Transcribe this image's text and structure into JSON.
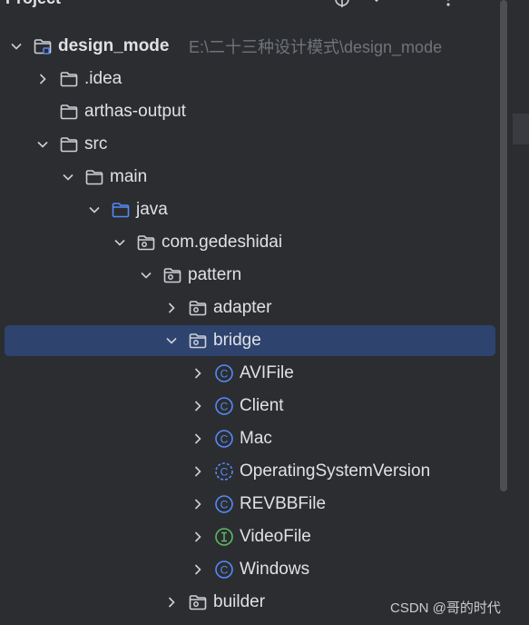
{
  "header": {
    "title": "Project",
    "icons": [
      "target-icon",
      "chevron-down-icon",
      "more-icon"
    ]
  },
  "tree": [
    {
      "label": "design_mode",
      "path": "E:\\二十三种设计模式\\design_mode",
      "icon": "module-folder-icon",
      "chevron": "expanded",
      "bold": true
    },
    {
      "label": ".idea",
      "icon": "folder-icon",
      "chevron": "collapsed"
    },
    {
      "label": "arthas-output",
      "icon": "folder-icon",
      "chevron": "none"
    },
    {
      "label": "src",
      "icon": "folder-icon",
      "chevron": "expanded"
    },
    {
      "label": "main",
      "icon": "folder-icon",
      "chevron": "expanded"
    },
    {
      "label": "java",
      "icon": "source-folder-icon",
      "chevron": "expanded"
    },
    {
      "label": "com.gedeshidai",
      "icon": "package-icon",
      "chevron": "expanded"
    },
    {
      "label": "pattern",
      "icon": "package-icon",
      "chevron": "expanded"
    },
    {
      "label": "adapter",
      "icon": "package-icon",
      "chevron": "collapsed"
    },
    {
      "label": "bridge",
      "icon": "package-icon",
      "chevron": "expanded",
      "selected": true
    },
    {
      "label": "AVIFile",
      "icon": "class-icon",
      "chevron": "collapsed"
    },
    {
      "label": "Client",
      "icon": "class-icon",
      "chevron": "collapsed"
    },
    {
      "label": "Mac",
      "icon": "class-icon",
      "chevron": "collapsed"
    },
    {
      "label": "OperatingSystemVersion",
      "icon": "abstract-class-icon",
      "chevron": "collapsed"
    },
    {
      "label": "REVBBFile",
      "icon": "class-icon",
      "chevron": "collapsed"
    },
    {
      "label": "VideoFile",
      "icon": "interface-icon",
      "chevron": "collapsed"
    },
    {
      "label": "Windows",
      "icon": "class-icon",
      "chevron": "collapsed"
    },
    {
      "label": "builder",
      "icon": "package-icon",
      "chevron": "collapsed"
    }
  ],
  "watermark": "CSDN @哥的时代",
  "colors": {
    "background": "#2b2d30",
    "text": "#dfe1e5",
    "path": "#6f737a",
    "selection": "#2e436e",
    "class_icon": "#548af7",
    "interface_icon": "#5fb865",
    "folder_icon": "#ced0d6",
    "source_folder_icon": "#548af7"
  }
}
